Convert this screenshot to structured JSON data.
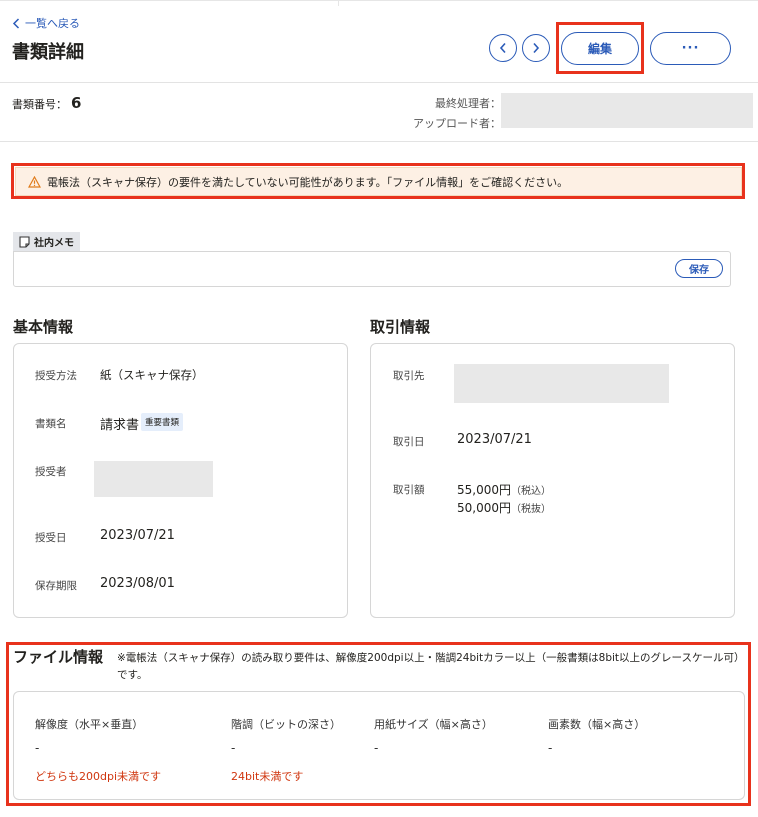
{
  "header": {
    "back_label": "一覧へ戻る",
    "title": "書類詳細",
    "edit_label": "編集",
    "more_label": "···"
  },
  "doc": {
    "number_label": "書類番号：",
    "number_value": "6",
    "processor_label": "最終処理者：",
    "uploader_label": "アップロード者："
  },
  "warning": {
    "text": "電帳法（スキャナ保存）の要件を満たしていない可能性があります。「ファイル情報」をご確認ください。"
  },
  "memo": {
    "tab_label": "社内メモ",
    "save_label": "保存"
  },
  "basic": {
    "title": "基本情報",
    "method_label": "授受方法",
    "method_value": "紙（スキャナ保存）",
    "doctype_label": "書類名",
    "doctype_value": "請求書",
    "doctype_tag": "重要書類",
    "person_label": "授受者",
    "date_label": "授受日",
    "date_value": "2023/07/21",
    "retention_label": "保存期限",
    "retention_value": "2023/08/01"
  },
  "trade": {
    "title": "取引情報",
    "partner_label": "取引先",
    "date_label": "取引日",
    "date_value": "2023/07/21",
    "amount_label": "取引額",
    "amount_incl": "55,000円",
    "amount_incl_note": "（税込）",
    "amount_excl": "50,000円",
    "amount_excl_note": "（税抜）"
  },
  "file": {
    "title": "ファイル情報",
    "note": "※電帳法（スキャナ保存）の読み取り要件は、解像度200dpi以上・階調24bitカラー以上（一般書類は8bit以上のグレースケール可）です。",
    "columns": [
      {
        "header": "解像度（水平×垂直）",
        "value": "-",
        "warning": "どちらも200dpi未満です"
      },
      {
        "header": "階調（ビットの深さ）",
        "value": "-",
        "warning": "24bit未満です"
      },
      {
        "header": "用紙サイズ（幅×高さ）",
        "value": "-",
        "warning": ""
      },
      {
        "header": "画素数（幅×高さ）",
        "value": "-",
        "warning": ""
      }
    ]
  },
  "colors": {
    "accent": "#2b5bb8",
    "highlight": "#e8321c",
    "warning_bg": "#fdf0e4",
    "warning_text": "#d0360f"
  }
}
